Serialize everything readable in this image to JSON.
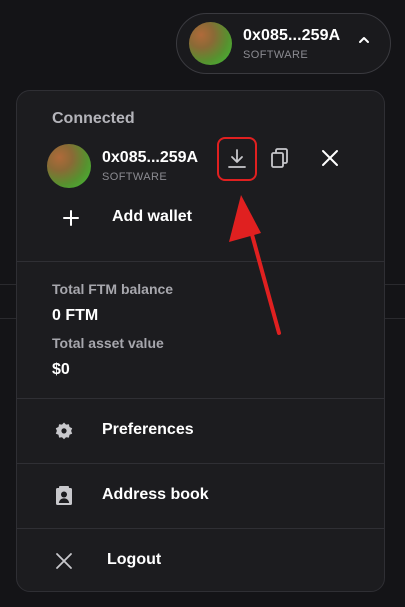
{
  "account": {
    "address": "0x085...259A",
    "wallet_type": "SOFTWARE",
    "avatar": "gradient-avatar",
    "caret_icon": "chevron-up-icon"
  },
  "panel": {
    "connected_label": "Connected",
    "wallet_row": {
      "address": "0x085...259A",
      "wallet_type": "SOFTWARE",
      "actions": [
        "download-icon",
        "copy-icon",
        "close-icon"
      ]
    },
    "add_wallet_label": "Add wallet",
    "balances": {
      "ftm_label": "Total FTM balance",
      "ftm_value": "0 FTM",
      "asset_label": "Total asset value",
      "asset_value": "$0"
    },
    "menu": {
      "preferences": "Preferences",
      "address_book": "Address book",
      "logout": "Logout"
    }
  },
  "annotation": {
    "highlight_color": "#e02020",
    "arrow_color": "#e02020"
  }
}
